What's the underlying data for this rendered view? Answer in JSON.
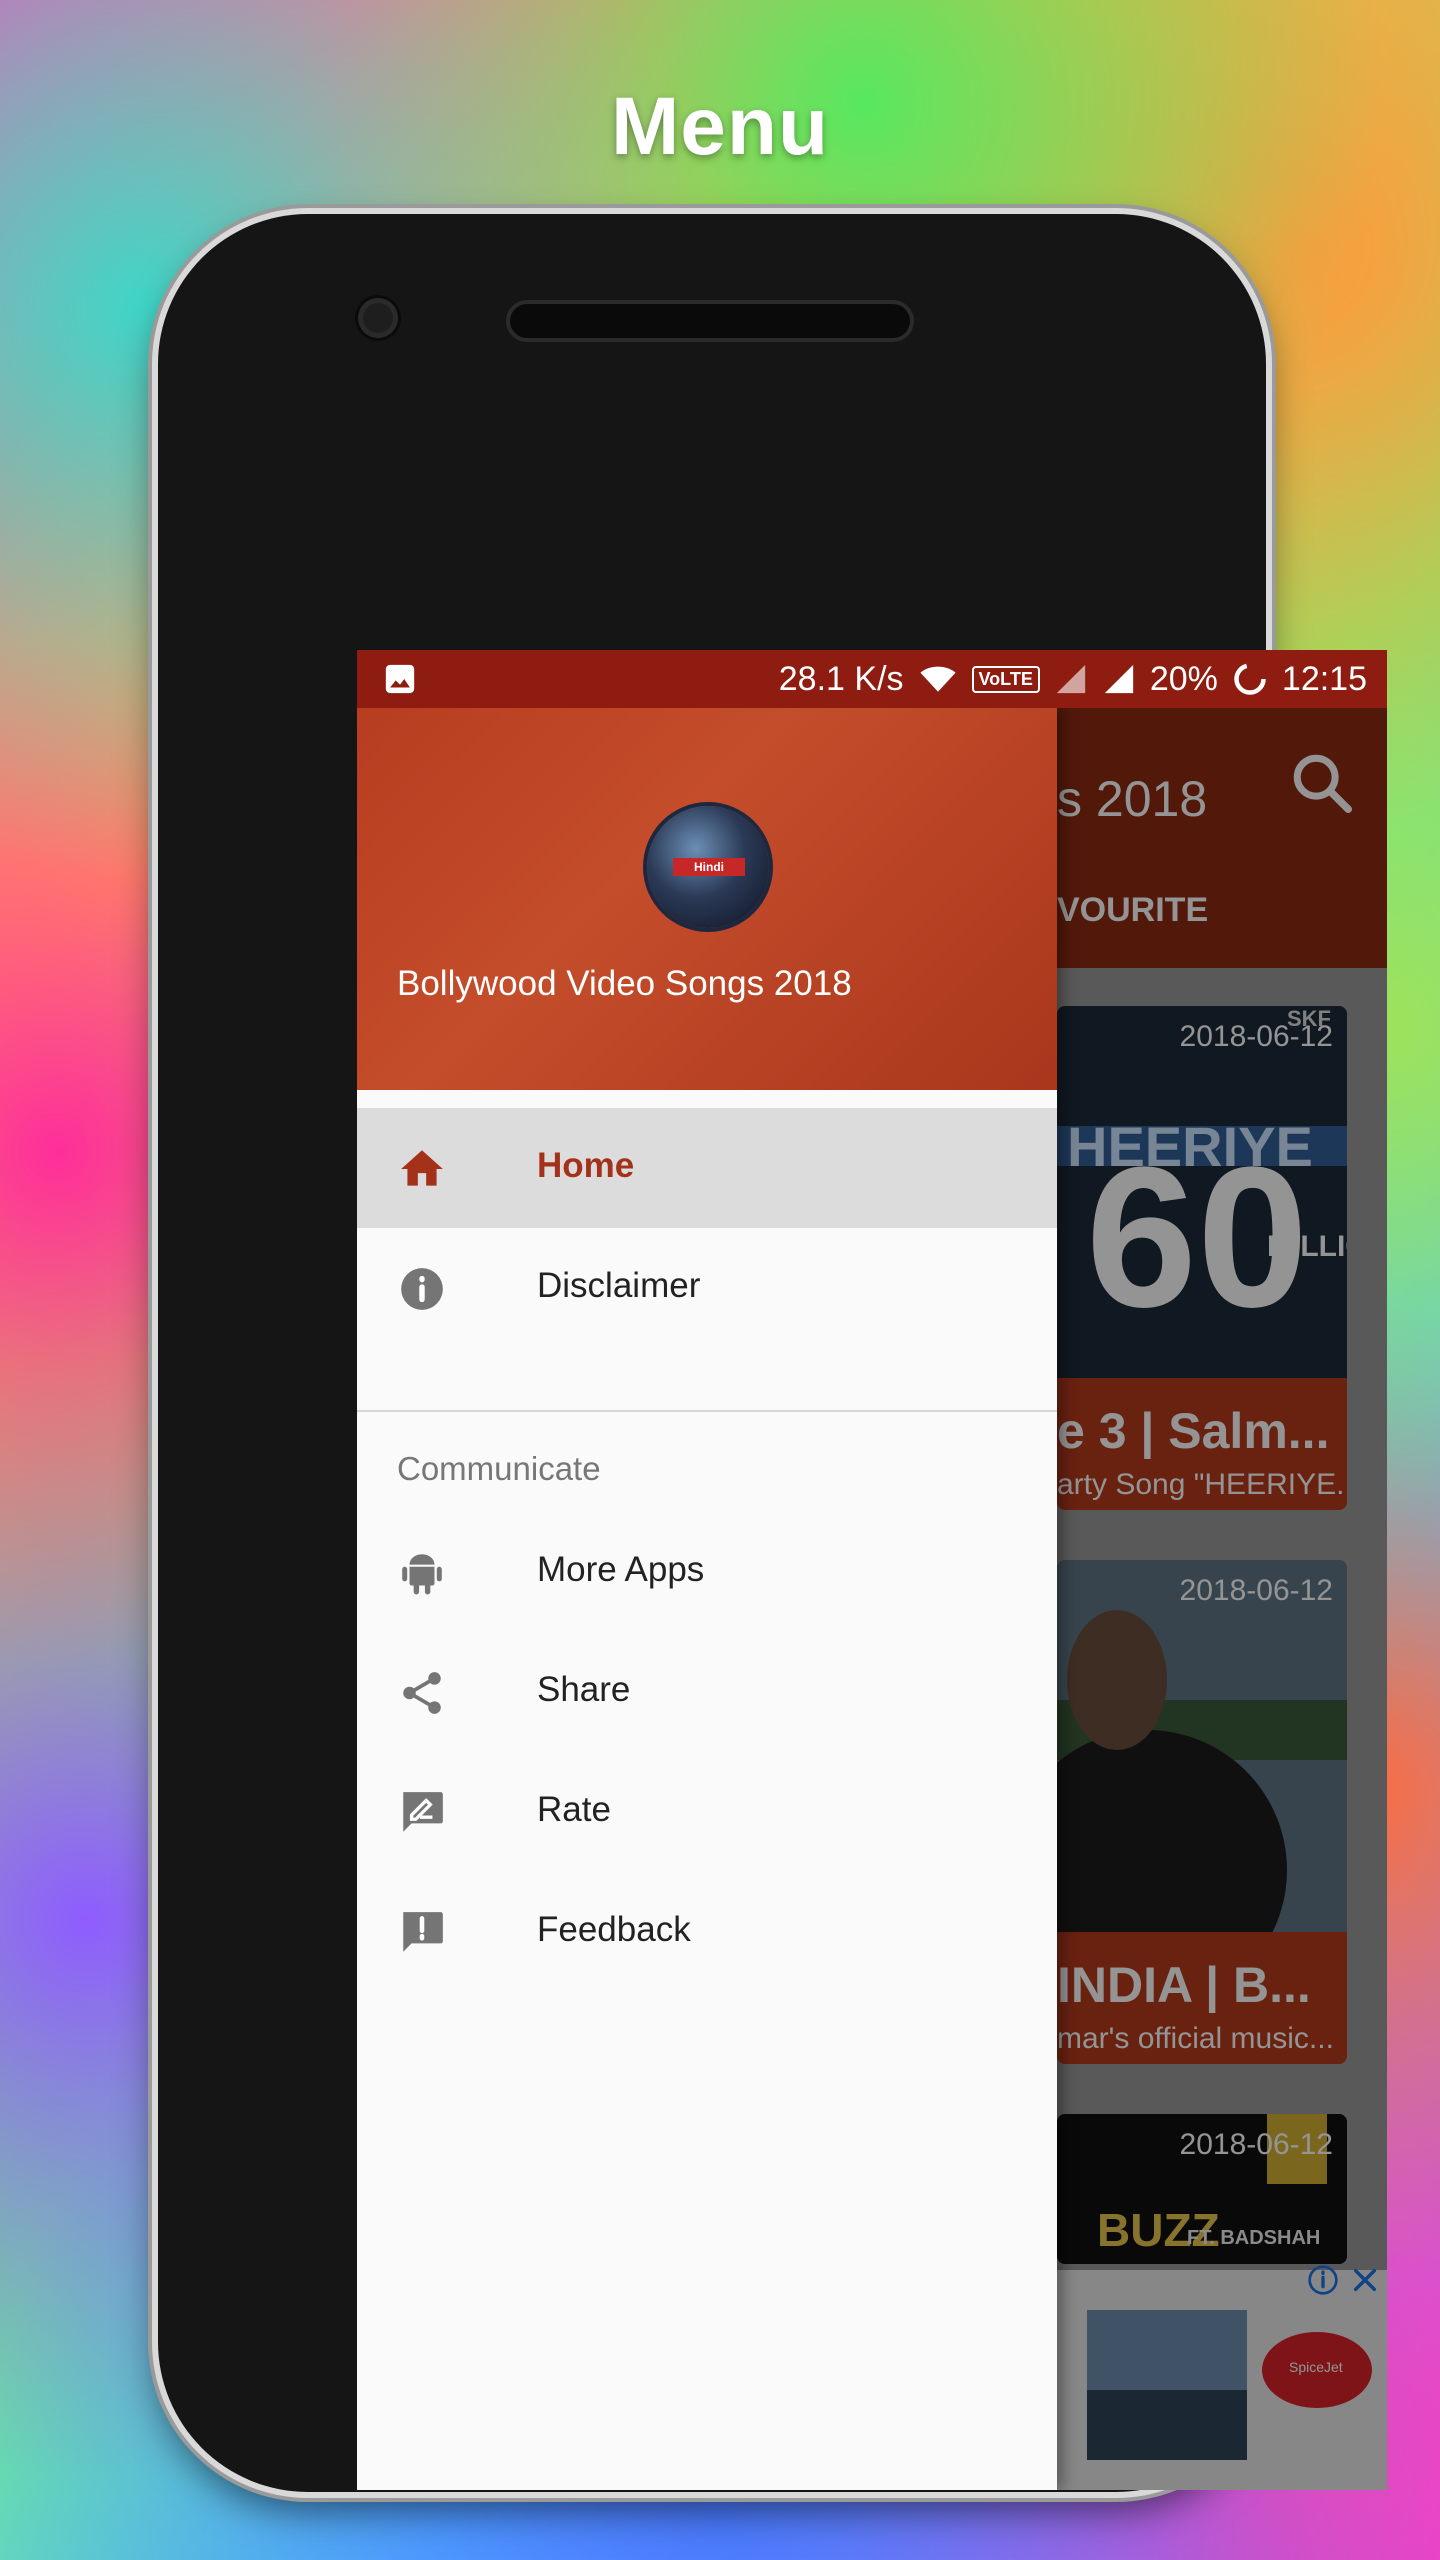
{
  "headline": "Menu",
  "status_bar": {
    "network_speed": "28.1 K/s",
    "volte": "VoLTE",
    "battery": "20%",
    "time": "12:15"
  },
  "background_app": {
    "title_visible": "s 2018",
    "tab_visible": "VOURITE",
    "cards": [
      {
        "date": "2018-06-12",
        "title": "e 3 | Salm...",
        "subtitle": "arty Song \"HEERIYE..."
      },
      {
        "date": "2018-06-12",
        "title": "INDIA | B...",
        "subtitle": "mar's official music..."
      },
      {
        "date": "2018-06-12"
      }
    ],
    "card_art": {
      "big_number": "60",
      "million": "MILLION",
      "top_text": "HEERIYE",
      "tag": "SKF",
      "ft": "FT. BADSHAH",
      "buzz": "BUZZ"
    },
    "ad_brand": "SpiceJet"
  },
  "drawer": {
    "app_name": "Bollywood Video Songs 2018",
    "avatar_badge": "Hindi",
    "items": [
      {
        "label": "Home",
        "icon": "home-icon",
        "active": true
      },
      {
        "label": "Disclaimer",
        "icon": "info-icon",
        "active": false
      }
    ],
    "section_title": "Communicate",
    "communicate_items": [
      {
        "label": "More Apps",
        "icon": "android-icon"
      },
      {
        "label": "Share",
        "icon": "share-icon"
      },
      {
        "label": "Rate",
        "icon": "rate-icon"
      },
      {
        "label": "Feedback",
        "icon": "feedback-icon"
      }
    ]
  },
  "colors": {
    "accent": "#a4321a",
    "status_bar": "#8e1c10",
    "drawer_header": "#b73d20"
  }
}
